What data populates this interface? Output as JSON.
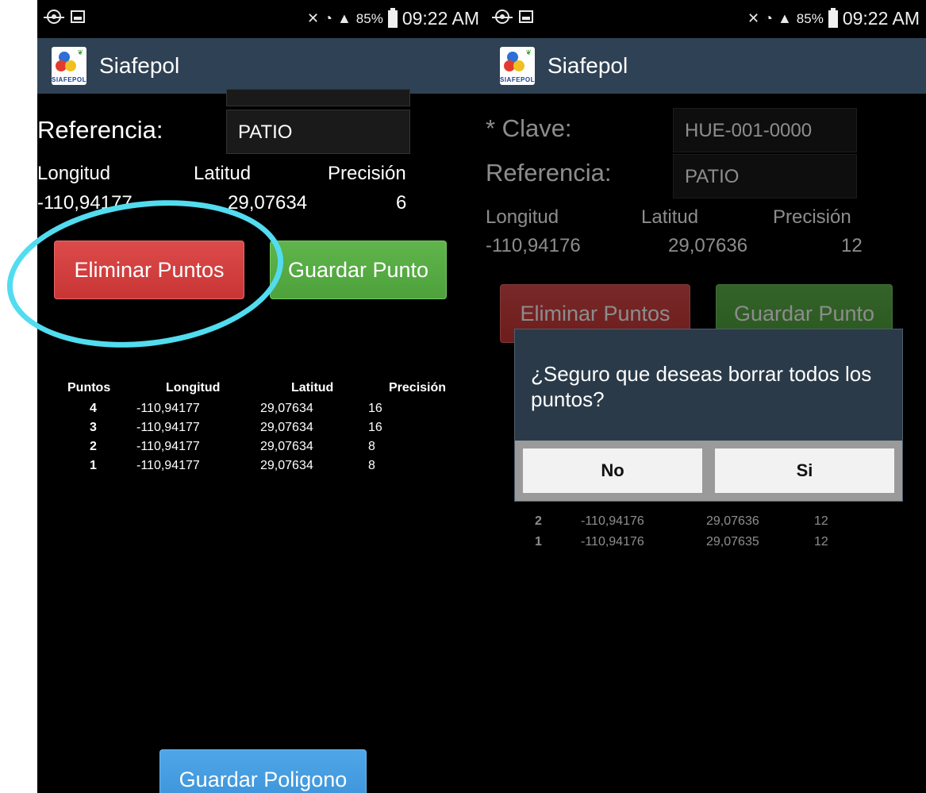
{
  "status_bar": {
    "battery_percent": "85%",
    "time": "09:22 AM"
  },
  "app": {
    "title": "Siafepol",
    "logo_text": "SIAFEPOL"
  },
  "left_screen": {
    "referencia_label": "Referencia:",
    "referencia_value": "PATIO",
    "headers": {
      "longitud": "Longitud",
      "latitud": "Latitud",
      "precision": "Precisión"
    },
    "current": {
      "longitud": "-110,94177",
      "latitud": "29,07634",
      "precision": "6"
    },
    "buttons": {
      "eliminar": "Eliminar Puntos",
      "guardar_punto": "Guardar Punto",
      "guardar_poligono": "Guardar Poligono"
    },
    "table": {
      "columns": [
        "Puntos",
        "Longitud",
        "Latitud",
        "Precisión"
      ],
      "rows": [
        [
          "4",
          "-110,94177",
          "29,07634",
          "16"
        ],
        [
          "3",
          "-110,94177",
          "29,07634",
          "16"
        ],
        [
          "2",
          "-110,94177",
          "29,07634",
          "8"
        ],
        [
          "1",
          "-110,94177",
          "29,07634",
          "8"
        ]
      ]
    }
  },
  "right_screen": {
    "clave_label": "* Clave:",
    "clave_value": "HUE-001-0000",
    "referencia_label": "Referencia:",
    "referencia_value": "PATIO",
    "headers": {
      "longitud": "Longitud",
      "latitud": "Latitud",
      "precision": "Precisión"
    },
    "current": {
      "longitud": "-110,94176",
      "latitud": "29,07636",
      "precision": "12"
    },
    "buttons": {
      "eliminar": "Eliminar Puntos",
      "guardar_punto": "Guardar Punto"
    },
    "table": {
      "rows": [
        [
          "2",
          "-110,94176",
          "29,07636",
          "12"
        ],
        [
          "1",
          "-110,94176",
          "29,07635",
          "12"
        ]
      ]
    },
    "dialog": {
      "message": "¿Seguro que deseas borrar todos los puntos?",
      "no_label": "No",
      "yes_label": "Si"
    }
  },
  "colors": {
    "appbar": "#2f4154",
    "highlight_circle": "#52dcef",
    "delete_button": "#d94040",
    "save_button": "#56ab43",
    "polygon_button": "#4a9fe2"
  }
}
